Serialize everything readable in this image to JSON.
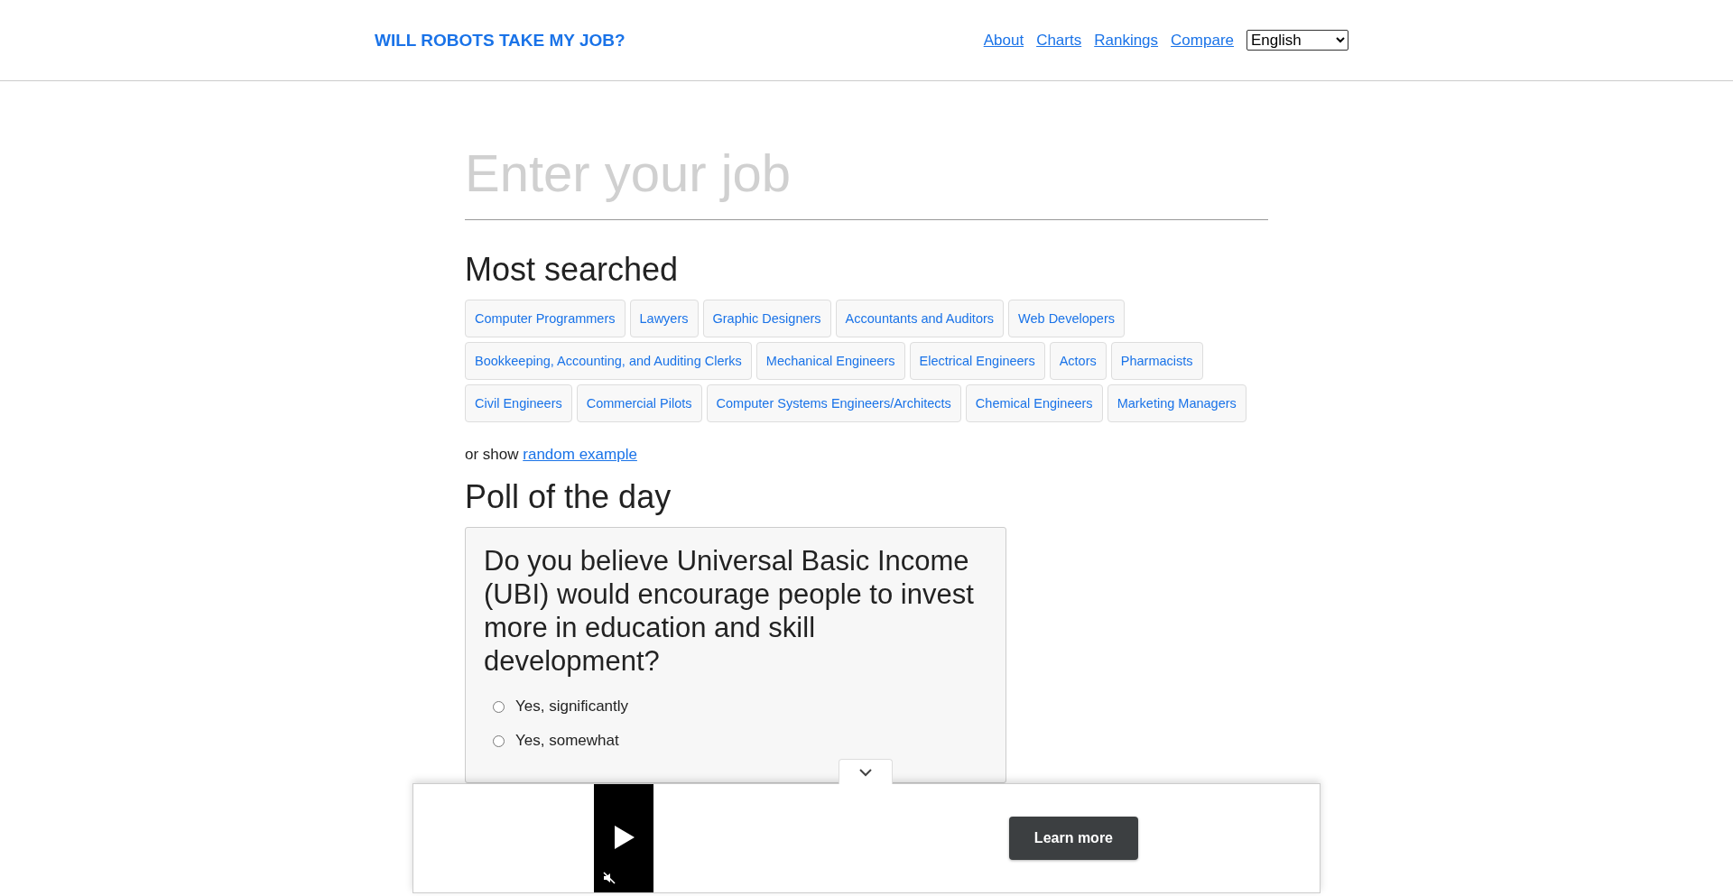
{
  "header": {
    "logo": "WILL ROBOTS TAKE MY JOB?",
    "nav": [
      "About",
      "Charts",
      "Rankings",
      "Compare"
    ],
    "language": "English"
  },
  "search": {
    "placeholder": "Enter your job"
  },
  "most_searched": {
    "title": "Most searched",
    "jobs": [
      "Computer Programmers",
      "Lawyers",
      "Graphic Designers",
      "Accountants and Auditors",
      "Web Developers",
      "Bookkeeping, Accounting, and Auditing Clerks",
      "Mechanical Engineers",
      "Electrical Engineers",
      "Actors",
      "Pharmacists",
      "Civil Engineers",
      "Commercial Pilots",
      "Computer Systems Engineers/Architects",
      "Chemical Engineers",
      "Marketing Managers"
    ]
  },
  "random": {
    "prefix": "or show",
    "link": "random example"
  },
  "poll": {
    "title": "Poll of the day",
    "question": "Do you believe Universal Basic Income (UBI) would encourage people to invest more in education and skill development?",
    "options": [
      {
        "label": "Yes, significantly",
        "selected": false
      },
      {
        "label": "Yes, somewhat",
        "selected": false
      }
    ]
  },
  "ad": {
    "button": "Learn more"
  }
}
